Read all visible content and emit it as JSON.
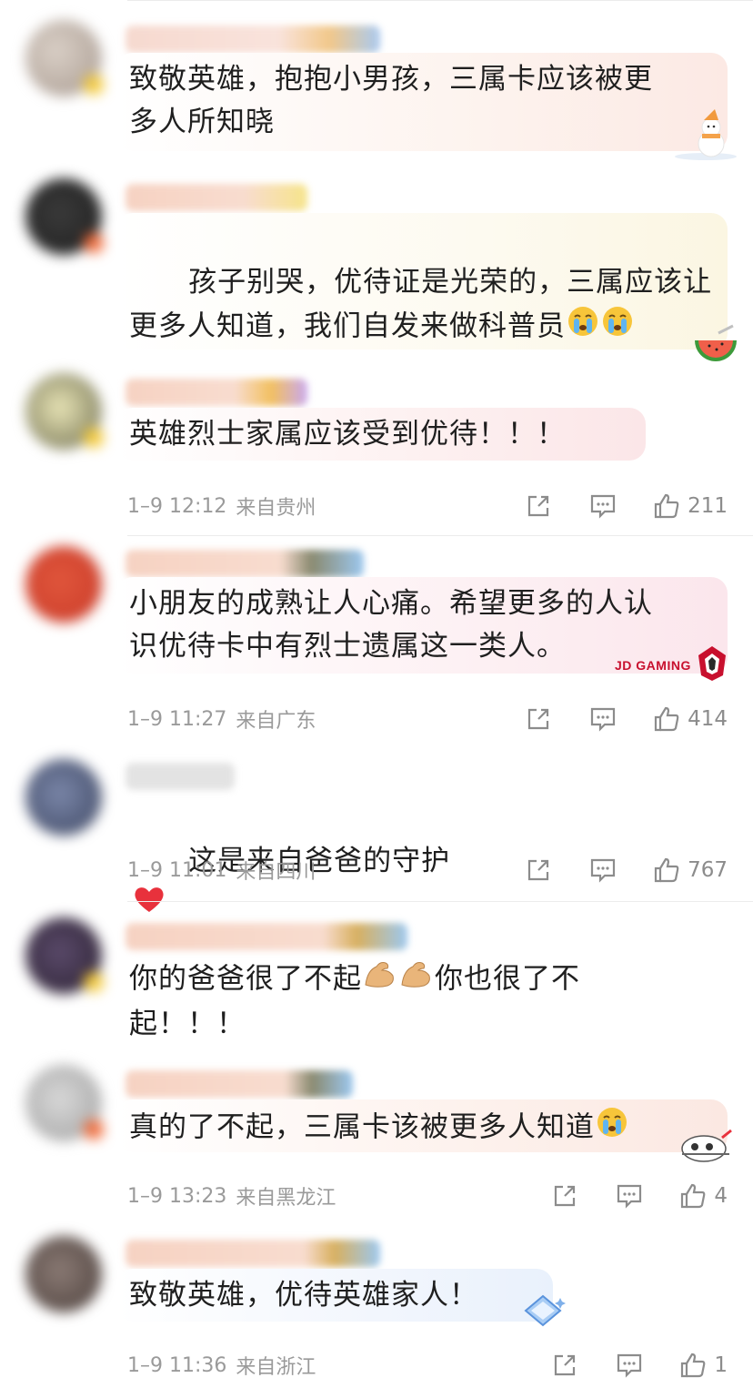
{
  "comments": [
    {
      "text": "致敬英雄，抱抱小男孩，三属卡应该被更\n多人所知晓",
      "time": "",
      "location": "",
      "likes": ""
    },
    {
      "text": "孩子别哭，优待证是光荣的，三属应该让\n更多人知道，我们自发来做科普员",
      "time": "",
      "location": "",
      "likes": ""
    },
    {
      "text": "英雄烈士家属应该受到优待！！！",
      "time": "1–9 12:12",
      "location": "来自贵州",
      "likes": "211"
    },
    {
      "text": "小朋友的成熟让人心痛。希望更多的人认\n识优待卡中有烈士遗属这一类人。",
      "time": "1–9 11:27",
      "location": "来自广东",
      "likes": "414",
      "badge_text": "JD GAMING"
    },
    {
      "text": "这是来自爸爸的守护",
      "time": "1–9 11:01",
      "location": "来自四川",
      "likes": "767"
    },
    {
      "text_a": "你的爸爸很了不起",
      "text_b": "你也很了不",
      "text_c": "起！！！",
      "time": "",
      "location": "",
      "likes": ""
    },
    {
      "text": "真的了不起，三属卡该被更多人知道",
      "time": "1–9 13:23",
      "location": "来自黑龙江",
      "likes": "4"
    },
    {
      "text": "致敬英雄，优待英雄家人！",
      "time": "1–9 11:36",
      "location": "来自浙江",
      "likes": "1"
    }
  ],
  "colors": {
    "meta_text": "#9a9a9a",
    "heart": "#e8313c",
    "divider": "#ececec"
  },
  "icons": [
    "share-icon",
    "comment-icon",
    "thumbs-up-icon",
    "heart-icon",
    "crying-face-icon",
    "flexed-biceps-icon"
  ]
}
